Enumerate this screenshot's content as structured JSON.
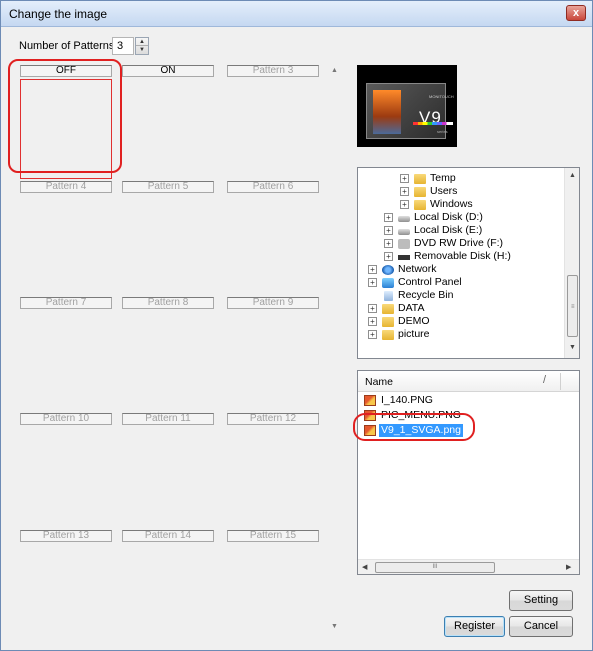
{
  "window": {
    "title": "Change the image",
    "close_glyph": "x"
  },
  "patterns_count": {
    "label": "Number of Patterns",
    "value": "3"
  },
  "patterns": [
    {
      "label": "OFF",
      "active": true
    },
    {
      "label": "ON",
      "active": true
    },
    {
      "label": "Pattern 3",
      "active": false
    },
    {
      "label": "Pattern 4",
      "active": false
    },
    {
      "label": "Pattern 5",
      "active": false
    },
    {
      "label": "Pattern 6",
      "active": false
    },
    {
      "label": "Pattern 7",
      "active": false
    },
    {
      "label": "Pattern 8",
      "active": false
    },
    {
      "label": "Pattern 9",
      "active": false
    },
    {
      "label": "Pattern 10",
      "active": false
    },
    {
      "label": "Pattern 11",
      "active": false
    },
    {
      "label": "Pattern 12",
      "active": false
    },
    {
      "label": "Pattern 13",
      "active": false
    },
    {
      "label": "Pattern 14",
      "active": false
    },
    {
      "label": "Pattern 15",
      "active": false
    }
  ],
  "preview": {
    "text": "V9",
    "brand": "MONITOUCH",
    "series": "series"
  },
  "folder_tree": [
    {
      "label": "Temp",
      "expander": "+",
      "icon": "folder-icon"
    },
    {
      "label": "Users",
      "expander": "+",
      "icon": "folder-icon"
    },
    {
      "label": "Windows",
      "expander": "+",
      "icon": "folder-icon"
    },
    {
      "label": "Local Disk (D:)",
      "expander": "+",
      "icon": "disk-icon"
    },
    {
      "label": "Local Disk (E:)",
      "expander": "+",
      "icon": "disk-icon"
    },
    {
      "label": "DVD RW Drive (F:)",
      "expander": "+",
      "icon": "dvd-icon"
    },
    {
      "label": "Removable Disk (H:)",
      "expander": "+",
      "icon": "removable-disk-icon"
    },
    {
      "label": "Network",
      "expander": "+",
      "icon": "network-icon"
    },
    {
      "label": "Control Panel",
      "expander": "+",
      "icon": "control-panel-icon"
    },
    {
      "label": "Recycle Bin",
      "expander": "",
      "icon": "recycle-bin-icon"
    },
    {
      "label": "DATA",
      "expander": "+",
      "icon": "folder-icon"
    },
    {
      "label": "DEMO",
      "expander": "+",
      "icon": "folder-icon"
    },
    {
      "label": "picture",
      "expander": "+",
      "icon": "folder-icon"
    }
  ],
  "file_list": {
    "column_name": "Name",
    "sort_glyph": "/",
    "files": [
      {
        "name": "I_140.PNG",
        "selected": false
      },
      {
        "name": "PIC_MENU.PNG",
        "selected": false
      },
      {
        "name": "V9_1_SVGA.png",
        "selected": true
      }
    ],
    "hscroll_grip": "III"
  },
  "buttons": {
    "setting": "Setting",
    "register": "Register",
    "cancel": "Cancel"
  },
  "scroll_glyphs": {
    "up": "▲",
    "down": "▼",
    "left": "◀",
    "right": "▶",
    "grip": "≡"
  }
}
